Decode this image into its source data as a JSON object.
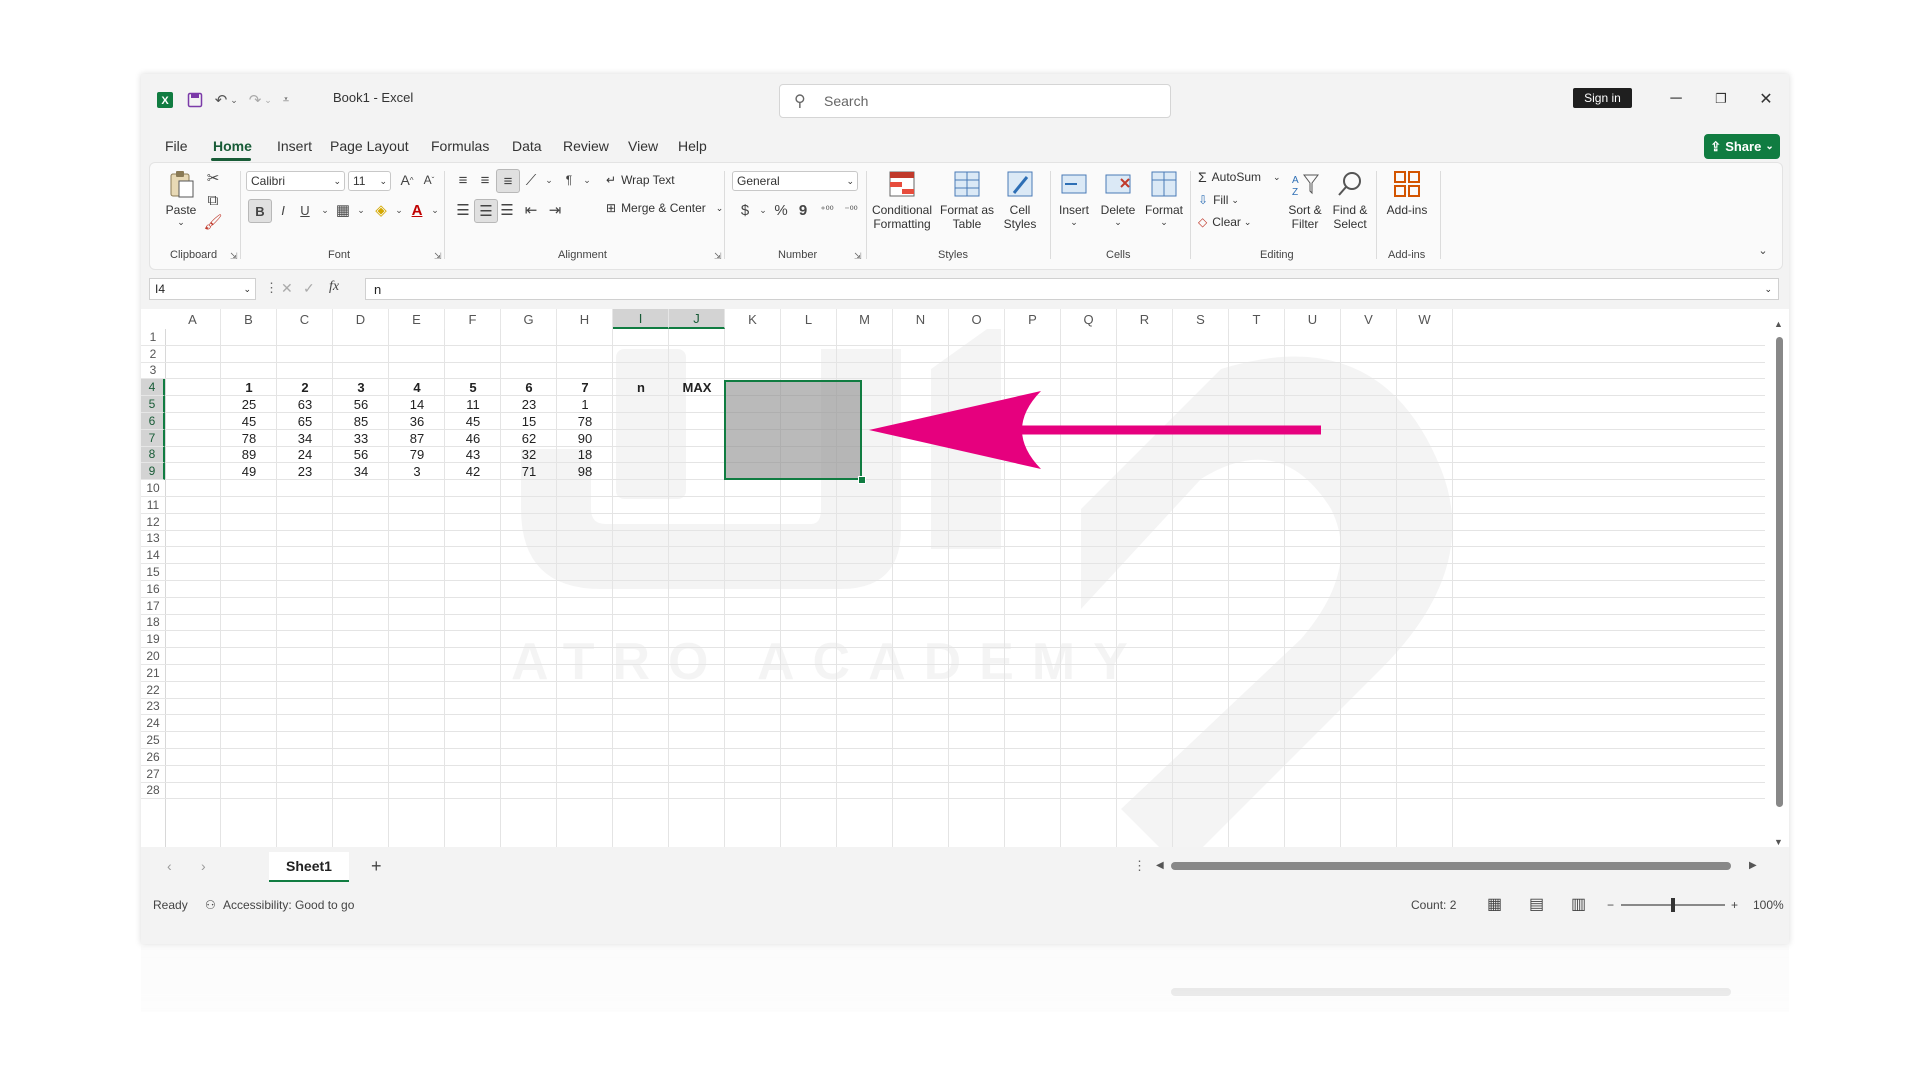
{
  "titlebar": {
    "doc_title": "Book1  -  Excel",
    "search_placeholder": "Search",
    "signin_label": "Sign in",
    "icons": [
      "excel-logo-icon",
      "save-icon",
      "undo-icon",
      "redo-icon",
      "customize-qat-icon"
    ]
  },
  "menu": {
    "tabs": [
      "File",
      "Home",
      "Insert",
      "Page Layout",
      "Formulas",
      "Data",
      "Review",
      "View",
      "Help"
    ],
    "active": "Home",
    "share_label": "Share"
  },
  "ribbon": {
    "clipboard": {
      "label": "Clipboard",
      "paste": "Paste"
    },
    "font": {
      "label": "Font",
      "name": "Calibri",
      "size": "11",
      "bold": "B",
      "italic": "I",
      "underline": "U"
    },
    "alignment": {
      "label": "Alignment",
      "wrap": "Wrap Text",
      "merge": "Merge & Center"
    },
    "number": {
      "label": "Number",
      "format": "General",
      "currency": "$",
      "percent": "%",
      "comma": "9"
    },
    "styles": {
      "label": "Styles",
      "conditional": "Conditional\nFormatting",
      "format_table": "Format as\nTable",
      "cell_styles": "Cell\nStyles"
    },
    "cells": {
      "label": "Cells",
      "insert": "Insert",
      "delete": "Delete",
      "format": "Format"
    },
    "editing": {
      "label": "Editing",
      "autosum": "AutoSum",
      "fill": "Fill",
      "clear": "Clear",
      "sort": "Sort &\nFilter",
      "find": "Find &\nSelect"
    },
    "addins": {
      "label": "Add-ins",
      "addins": "Add-ins"
    }
  },
  "formula_bar": {
    "name_box": "I4",
    "fx": "fx",
    "content": "n"
  },
  "grid": {
    "columns": [
      "A",
      "B",
      "C",
      "D",
      "E",
      "F",
      "G",
      "H",
      "I",
      "J",
      "K",
      "L",
      "M",
      "N",
      "O",
      "P",
      "Q",
      "R",
      "S",
      "T",
      "U",
      "V",
      "W"
    ],
    "selected_columns": [
      "I",
      "J"
    ],
    "rows": [
      "1",
      "2",
      "3",
      "4",
      "5",
      "6",
      "7",
      "8",
      "9",
      "10",
      "11",
      "12",
      "13",
      "14",
      "15",
      "16",
      "17",
      "18",
      "19",
      "20",
      "21",
      "22",
      "23",
      "24",
      "25",
      "26",
      "27",
      "28"
    ],
    "selected_rows": [
      "4",
      "5",
      "6",
      "7",
      "8",
      "9"
    ],
    "header_row": [
      "1",
      "2",
      "3",
      "4",
      "5",
      "6",
      "7"
    ],
    "data": [
      [
        "25",
        "63",
        "56",
        "14",
        "11",
        "23",
        "1"
      ],
      [
        "45",
        "65",
        "85",
        "36",
        "45",
        "15",
        "78"
      ],
      [
        "78",
        "34",
        "33",
        "87",
        "46",
        "62",
        "90"
      ],
      [
        "89",
        "24",
        "56",
        "79",
        "43",
        "32",
        "18"
      ],
      [
        "49",
        "23",
        "34",
        "3",
        "42",
        "71",
        "98"
      ]
    ],
    "i4": "n",
    "j4": "MAX"
  },
  "annotation": {
    "arrow_color": "#e6007e"
  },
  "watermark": {
    "text": "ATRO ACADEMY"
  },
  "sheets": {
    "tabs": [
      "Sheet1"
    ],
    "add": "+"
  },
  "status": {
    "ready": "Ready",
    "accessibility": "Accessibility: Good to go",
    "count": "Count: 2",
    "zoom": "100%",
    "zoom_level": 0.5
  },
  "colors": {
    "accent": "#107c41",
    "accent_dark": "#185c37",
    "arrow": "#e6007e"
  }
}
